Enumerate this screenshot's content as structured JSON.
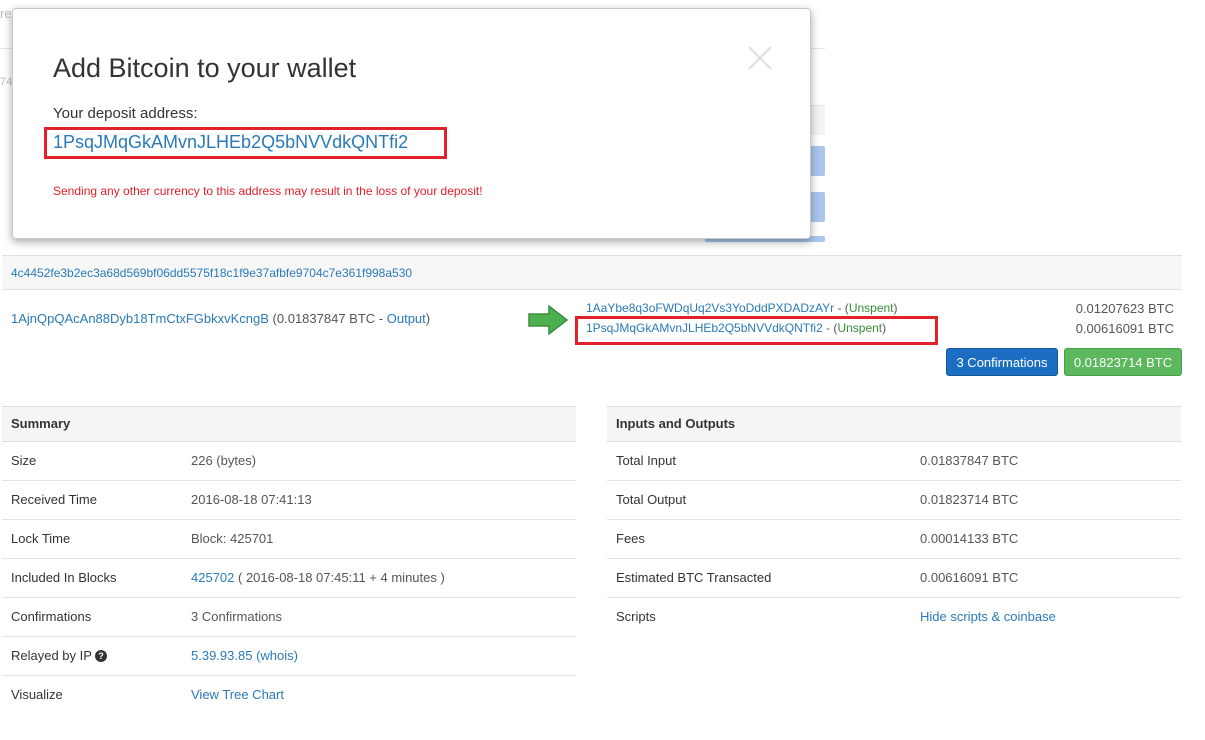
{
  "background": {
    "fragment_top": "re",
    "fragment_mid": "74"
  },
  "transaction": {
    "hash": "4c4452fe3b2ec3a68d569bf06dd5575f18c1f9e37afbfe9704c7e361f998a530",
    "input": {
      "address": "1AjnQpQAcAn88Dyb18TmCtxFGbkxvKcngB",
      "amount_prefix": " (0.01837847 BTC - ",
      "output_link": "Output",
      "amount_suffix": ")"
    },
    "outputs": [
      {
        "address": "1AaYbe8q3oFWDqUq2Vs3YoDddPXDADzAYr",
        "sep": " - (",
        "status": "Unspent",
        "close": ")",
        "amount": "0.01207623 BTC"
      },
      {
        "address": "1PsqJMqGkAMvnJLHEb2Q5bNVVdkQNTfi2",
        "sep": " - (",
        "status": "Unspent",
        "close": ")",
        "amount": "0.00616091 BTC"
      }
    ],
    "confirmations_badge": "3 Confirmations",
    "total_badge": "0.01823714 BTC"
  },
  "summary": {
    "title": "Summary",
    "rows": [
      {
        "key": "Size",
        "value": "226 (bytes)"
      },
      {
        "key": "Received Time",
        "value": "2016-08-18 07:41:13"
      },
      {
        "key": "Lock Time",
        "value": "Block: 425701"
      },
      {
        "key": "Included In Blocks",
        "value_link": "425702",
        "value": " ( 2016-08-18 07:45:11 + 4 minutes )"
      },
      {
        "key": "Confirmations",
        "value": "3 Confirmations"
      },
      {
        "key": "Relayed by IP",
        "value_link": "5.39.93.85",
        "value": " (whois)"
      },
      {
        "key": "Visualize",
        "value_link": "View Tree Chart"
      }
    ]
  },
  "io": {
    "title": "Inputs and Outputs",
    "rows": [
      {
        "key": "Total Input",
        "value": "0.01837847 BTC"
      },
      {
        "key": "Total Output",
        "value": "0.01823714 BTC"
      },
      {
        "key": "Fees",
        "value": "0.00014133 BTC"
      },
      {
        "key": "Estimated BTC Transacted",
        "value": "0.00616091 BTC"
      },
      {
        "key": "Scripts",
        "value_link": "Hide scripts & coinbase"
      }
    ]
  },
  "modal": {
    "title": "Add Bitcoin to your wallet",
    "label": "Your deposit address:",
    "address": "1PsqJMqGkAMvnJLHEb2Q5bNVVdkQNTfi2",
    "warning": "Sending any other currency to this address may result in the loss of your deposit!"
  },
  "colors": {
    "link": "#2a7ab8",
    "highlight": "#e3212a",
    "unspent": "#3a8c3a",
    "confirm_badge": "#1b6ec2",
    "total_badge": "#5cb85c"
  },
  "icons": {
    "close": "close-icon",
    "arrow": "arrow-right-icon",
    "help": "question-circle-icon"
  }
}
